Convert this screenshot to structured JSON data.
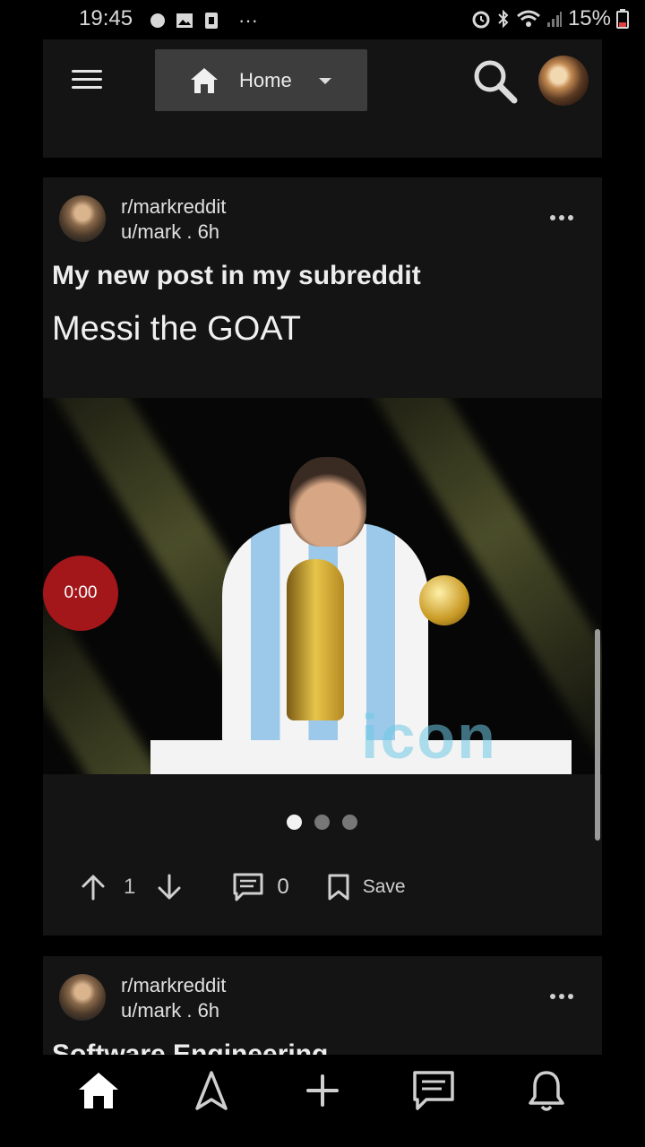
{
  "status_bar": {
    "time": "19:45",
    "ellipsis": "···",
    "battery": "15%",
    "icons": [
      "record-dot-icon",
      "image-icon",
      "sim-card-icon",
      "alarm-icon",
      "bluetooth-icon",
      "wifi-icon",
      "signal-icon",
      "battery-icon"
    ]
  },
  "header": {
    "menu_icon": "hamburger-menu-icon",
    "feed_selector": {
      "label": "Home",
      "icon": "home-icon"
    },
    "search_icon": "search-icon",
    "avatar": "user-avatar"
  },
  "posts": [
    {
      "subreddit": "r/markreddit",
      "author_time": "u/mark . 6h",
      "title": "My new post in my subreddit",
      "body": "Messi the GOAT",
      "media": {
        "timer": "0:00",
        "watermark": "icon"
      },
      "carousel_dots": 3,
      "carousel_active": 0,
      "score": "1",
      "comments": "0",
      "save_label": "Save"
    },
    {
      "subreddit": "r/markreddit",
      "author_time": "u/mark . 6h",
      "title": "Software Engineering"
    }
  ],
  "bottom_nav": [
    {
      "name": "home",
      "icon": "home-icon",
      "active": true
    },
    {
      "name": "explore",
      "icon": "navigation-arrow-icon"
    },
    {
      "name": "create",
      "icon": "plus-icon"
    },
    {
      "name": "chat",
      "icon": "chat-icon"
    },
    {
      "name": "notifications",
      "icon": "bell-icon"
    }
  ],
  "colors": {
    "background": "#000000",
    "card": "#141414",
    "dropdown": "#3d3d3d",
    "timer": "#a3161a"
  }
}
